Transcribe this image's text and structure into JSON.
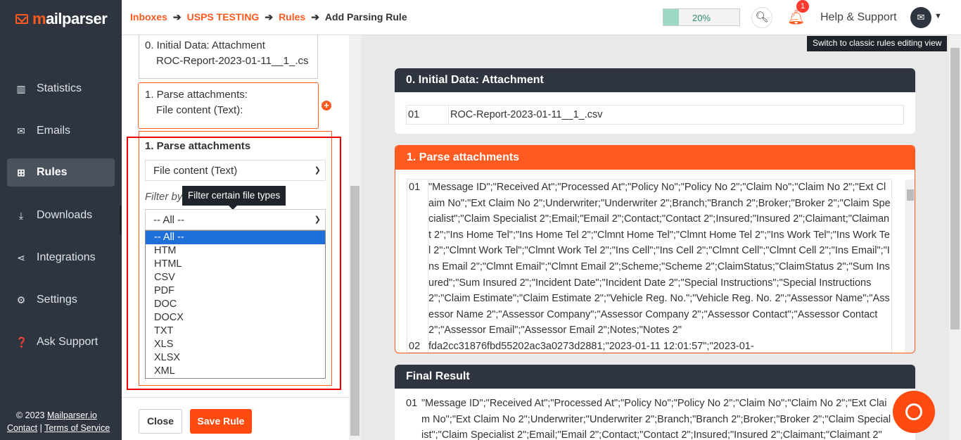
{
  "sidebar": {
    "logo_prefix": "m",
    "logo_text": "ailparser",
    "items": [
      {
        "label": "Statistics",
        "icon": "bar-chart-icon"
      },
      {
        "label": "Emails",
        "icon": "envelope-icon"
      },
      {
        "label": "Rules",
        "icon": "sitemap-icon",
        "active": true
      },
      {
        "label": "Downloads",
        "icon": "download-icon"
      },
      {
        "label": "Integrations",
        "icon": "share-icon"
      },
      {
        "label": "Settings",
        "icon": "gear-icon"
      },
      {
        "label": "Ask Support",
        "icon": "question-icon"
      }
    ],
    "copyright": "© 2023 ",
    "brand_link": "Mailparser.io",
    "contact": "Contact",
    "sep": " | ",
    "terms": "Terms of Service"
  },
  "header": {
    "crumbs": [
      "Inboxes",
      "USPS TESTING",
      "Rules",
      "Add Parsing Rule"
    ],
    "arrow": "➔",
    "progress": "20%",
    "notifications": "1",
    "help": "Help & Support",
    "tooltip": "Switch to classic rules editing view"
  },
  "left": {
    "step0_line1": "0. Initial Data: Attachment",
    "step0_line2": "ROC-Report-2023-01-11__1_.cs",
    "step1_line1": "1. Parse attachments:",
    "step1_line2": "File content (Text):",
    "editor_title": "1. Parse attachments",
    "content_select": "File content (Text)",
    "filter_label": "Filter by",
    "filter_tooltip": "Filter certain file types",
    "filter_value": "-- All --",
    "options": [
      "-- All --",
      "HTM",
      "HTML",
      "CSV",
      "PDF",
      "DOC",
      "DOCX",
      "TXT",
      "XLS",
      "XLSX",
      "XML"
    ],
    "close": "Close",
    "save": "Save Rule"
  },
  "cards": {
    "initial_title": "0. Initial Data: Attachment",
    "initial_row_num": "01",
    "initial_row_val": "ROC-Report-2023-01-11__1_.csv",
    "parse_title": "1. Parse attachments",
    "parse_rows": [
      {
        "n": "01",
        "v": "\"Message ID\";\"Received At\";\"Processed At\";\"Policy No\";\"Policy No 2\";\"Claim No\";\"Claim No 2\";\"Ext Claim No\";\"Ext Claim No 2\";Underwriter;\"Underwriter 2\";Branch;\"Branch 2\";Broker;\"Broker 2\";\"Claim Specialist\";\"Claim Specialist 2\";Email;\"Email 2\";Contact;\"Contact 2\";Insured;\"Insured 2\";Claimant;\"Claimant 2\";\"Ins Home Tel\";\"Ins Home Tel 2\";\"Clmnt Home Tel\";\"Clmnt Home Tel 2\";\"Ins Work Tel\";\"Ins Work Tel 2\";\"Clmnt Work Tel\";\"Clmnt Work Tel 2\";\"Ins Cell\";\"Ins Cell 2\";\"Clmnt Cell\";\"Clmnt Cell 2\";\"Ins Email\";\"Ins Email 2\";\"Clmnt Email\";\"Clmnt Email 2\";Scheme;\"Scheme 2\";ClaimStatus;\"ClaimStatus 2\";\"Sum Insured\";\"Sum Insured 2\";\"Incident Date\";\"Incident Date 2\";\"Special Instructions\";\"Special Instructions 2\";\"Claim Estimate\";\"Claim Estimate 2\";\"Vehicle Reg. No.\";\"Vehicle Reg. No. 2\";\"Assessor Name\";\"Assessor Name 2\";\"Assessor Company\";\"Assessor Company 2\";\"Assessor Contact\";\"Assessor Contact 2\";\"Assessor Email\";\"Assessor Email 2\";Notes;\"Notes 2\""
      },
      {
        "n": "02",
        "v": "fda2cc31876fbd55202ac3a0273d2881;\"2023-01-11 12:01:57\";\"2023-01-"
      }
    ],
    "final_title": "Final Result",
    "final_num": "01",
    "final_val": "\"Message ID\";\"Received At\";\"Processed At\";\"Policy No\";\"Policy No 2\";\"Claim No\";\"Claim No 2\";\"Ext Claim No\";\"Ext Claim No 2\";Underwriter;\"Underwriter 2\";Branch;\"Branch 2\";Broker;\"Broker 2\";\"Claim Specialist\";\"Claim Specialist 2\";Email;\"Email 2\";Contact;\"Contact 2\";Insured;\"Insured 2\";Claimant;\"Claimant 2\""
  }
}
